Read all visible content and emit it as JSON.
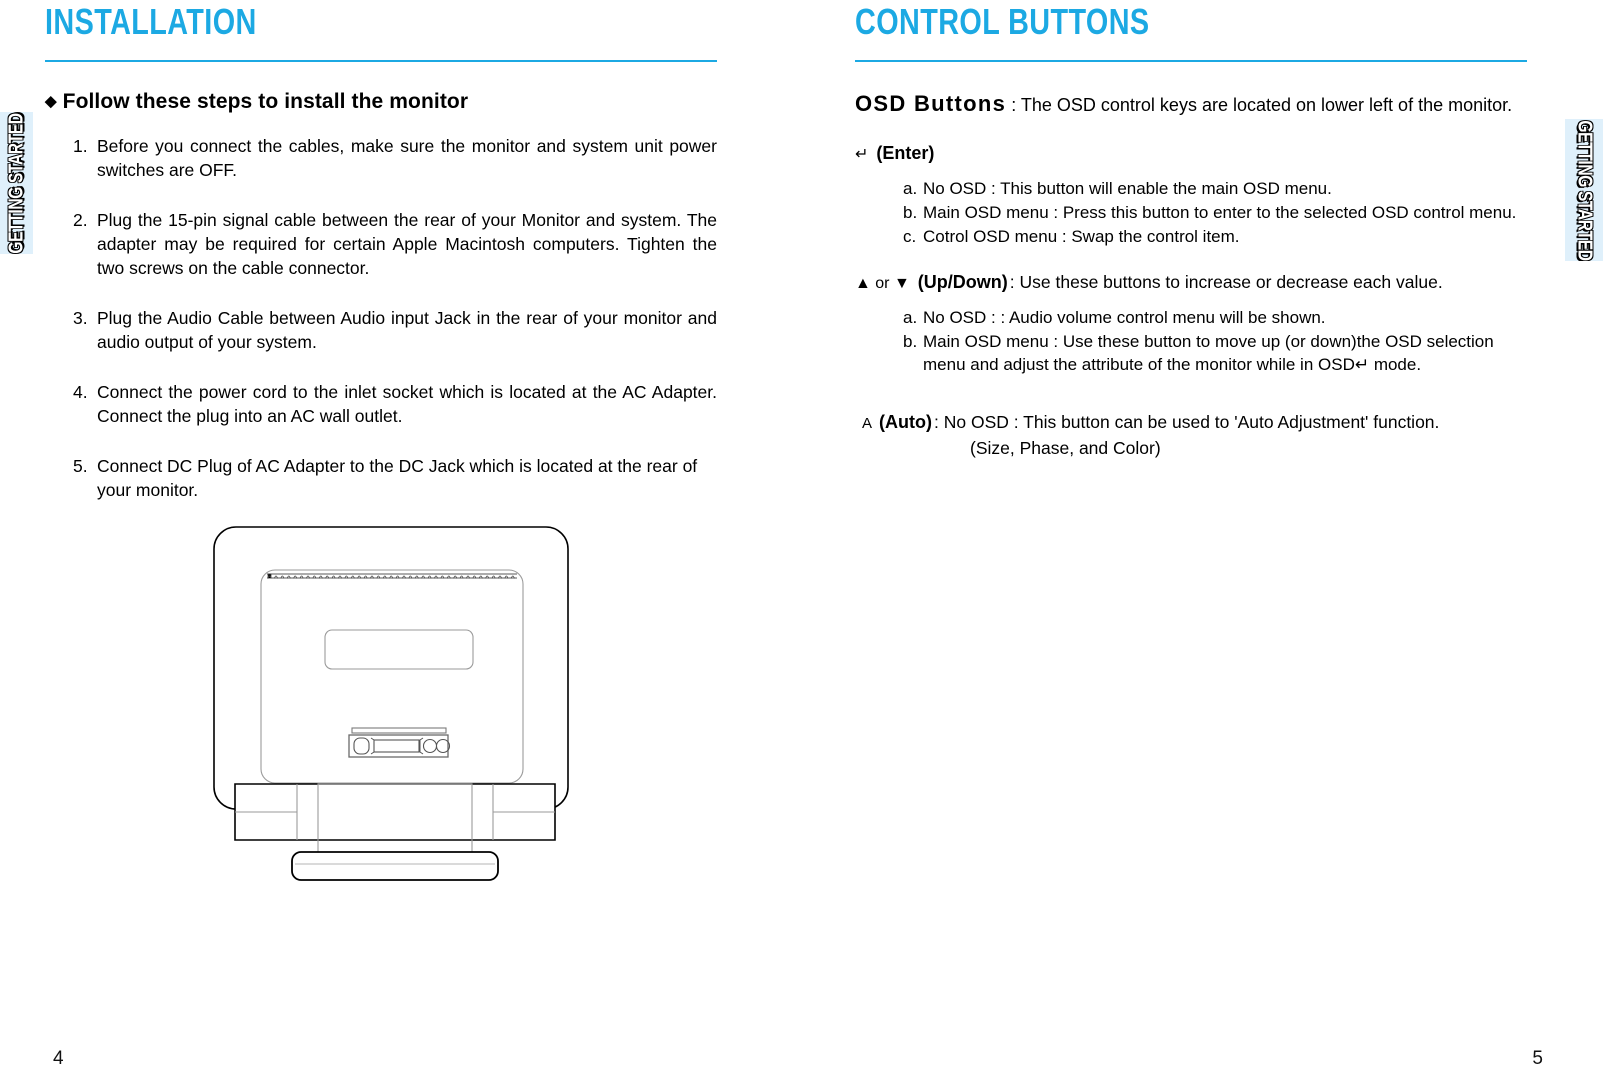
{
  "document": {
    "left_page_number": "4",
    "right_page_number": "5",
    "accent_color": "#1ca9e3",
    "tab_background": "#dff0fb"
  },
  "side_tabs": {
    "left_label": "GETTING STARTED",
    "right_label": "GETTING STARTED"
  },
  "left_column": {
    "title": "INSTALLATION",
    "bullet_glyph": "◆",
    "heading": "Follow these steps to install the monitor",
    "steps": [
      {
        "number": "1.",
        "text": "Before you connect the cables, make sure the monitor and system unit power switches are OFF."
      },
      {
        "number": "2.",
        "text": "Plug the 15-pin signal cable between the rear of your Monitor and system. The adapter may be required for certain Apple Macintosh computers. Tighten the two screws on the cable connector."
      },
      {
        "number": "3.",
        "text": "Plug the Audio Cable between Audio input Jack in the rear of your monitor and audio output of your system."
      },
      {
        "number": "4.",
        "text": "Connect the power cord to the inlet socket which is located at the AC Adapter. Connect the plug into an AC wall outlet."
      },
      {
        "number": "5.",
        "text": "Connect DC Plug of AC Adapter to the DC Jack which is located at the rear of your monitor."
      }
    ],
    "figure_name": "monitor-rear-view-diagram"
  },
  "right_column": {
    "title": "CONTROL BUTTONS",
    "osd_buttons_label": "OSD Buttons",
    "osd_buttons_description": ": The OSD control keys are located on lower left of the monitor.",
    "keys": [
      {
        "glyph": "↵",
        "glyph_name": "enter-key-icon",
        "name": "(Enter)",
        "description": "",
        "items": [
          {
            "label": "a.",
            "text": "No OSD : This button will enable the main OSD menu."
          },
          {
            "label": "b.",
            "text": "Main OSD menu : Press this button to enter to the selected OSD control menu."
          },
          {
            "label": "c.",
            "text": "Cotrol OSD menu : Swap the control item."
          }
        ]
      },
      {
        "glyph": "▲ or ▼",
        "glyph_name": "up-down-arrow-icon",
        "name": "(Up/Down)",
        "description": ": Use these buttons to increase or decrease each value.",
        "items": [
          {
            "label": "a.",
            "text": "No OSD : : Audio volume control menu will be shown."
          },
          {
            "label": "b.",
            "text": "Main OSD menu : Use these button to move up (or down)the OSD selection menu and adjust the attribute of the monitor while in OSD↵ mode."
          }
        ]
      }
    ],
    "auto_key": {
      "glyph": "A",
      "glyph_name": "auto-key-icon",
      "name": "(Auto)",
      "description": ": No OSD : This button can be used to 'Auto Adjustment' function.",
      "continuation": "(Size, Phase, and Color)"
    }
  }
}
